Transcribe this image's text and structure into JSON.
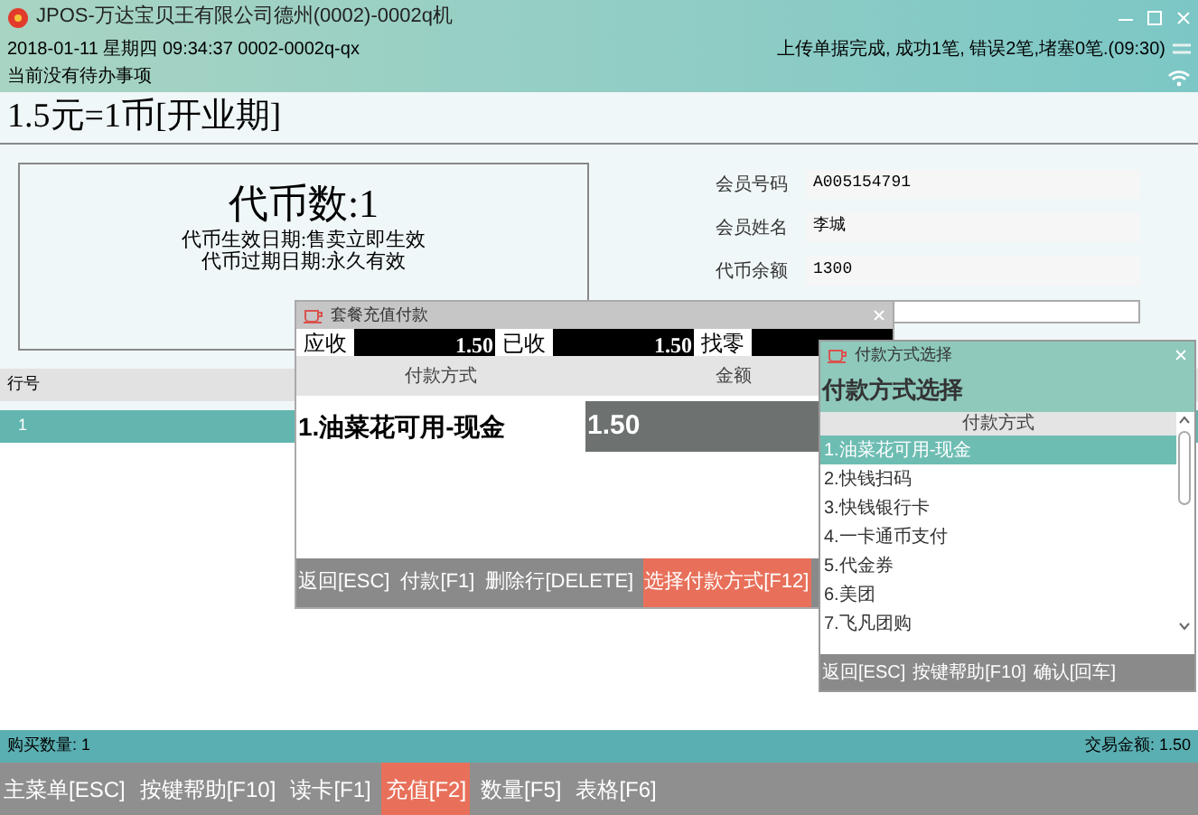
{
  "window": {
    "title": "JPOS-万达宝贝王有限公司德州(0002)-0002q机"
  },
  "info": {
    "datetime": "2018-01-11 星期四 09:34:37 0002-0002q-qx",
    "upload_status": "上传单据完成, 成功1笔, 错误2笔,堵塞0笔.(09:30)",
    "todo": "当前没有待办事项"
  },
  "rate_title": "1.5元=1币[开业期]",
  "token_card": {
    "count": "代币数:1",
    "lines": [
      "代币生效日期:售卖立即生效",
      "代币过期日期:永久有效"
    ]
  },
  "member": [
    {
      "label": "会员号码",
      "value": "A005154791"
    },
    {
      "label": "会员姓名",
      "value": "李城"
    },
    {
      "label": "代币余额",
      "value": "1300"
    }
  ],
  "table": {
    "columns": [
      "行号"
    ],
    "rows": [
      {
        "cells": [
          "1"
        ],
        "selected": true
      }
    ]
  },
  "payment_dialog": {
    "title": "套餐充值付款",
    "totals": [
      {
        "label": "应收",
        "value": "1.50"
      },
      {
        "label": "已收",
        "value": "1.50"
      },
      {
        "label": "找零"
      }
    ],
    "columns": [
      "付款方式",
      "金额"
    ],
    "rows": [
      {
        "method": "1.油菜花可用-现金",
        "amount": "1.50"
      }
    ],
    "actions": [
      {
        "label": "返回[ESC]",
        "selected": false
      },
      {
        "label": "付款[F1]",
        "selected": false
      },
      {
        "label": "删除行[DELETE]",
        "selected": false
      },
      {
        "label": "选择付款方式[F12]",
        "selected": true
      }
    ]
  },
  "method_dialog": {
    "title": "付款方式选择",
    "heading": "付款方式选择",
    "column": "付款方式",
    "items": [
      {
        "label": "1.油菜花可用-现金",
        "selected": true
      },
      {
        "label": "2.快钱扫码",
        "selected": false
      },
      {
        "label": "3.快钱银行卡",
        "selected": false
      },
      {
        "label": "4.一卡通币支付",
        "selected": false
      },
      {
        "label": "5.代金券",
        "selected": false
      },
      {
        "label": "6.美团",
        "selected": false
      },
      {
        "label": "7.飞凡团购",
        "selected": false
      }
    ],
    "actions": [
      "返回[ESC]",
      "按键帮助[F10]",
      "确认[回车]"
    ]
  },
  "status_bar": {
    "quantity": "购买数量: 1",
    "amount": "交易金额: 1.50"
  },
  "function_keys": [
    {
      "label": "主菜单[ESC]",
      "selected": false
    },
    {
      "label": "按键帮助[F10]",
      "selected": false
    },
    {
      "label": "读卡[F1]",
      "selected": false
    },
    {
      "label": "充值[F2]",
      "selected": true
    },
    {
      "label": "数量[F5]",
      "selected": false
    },
    {
      "label": "表格[F6]",
      "selected": false
    }
  ]
}
